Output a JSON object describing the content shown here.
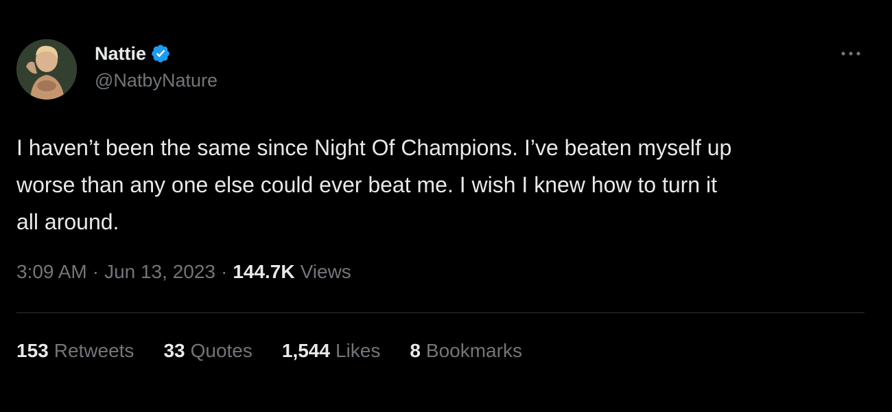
{
  "author": {
    "display_name": "Nattie",
    "handle": "@NatbyNature",
    "verified": true,
    "avatar_icon": "profile-photo"
  },
  "tweet": {
    "text": "I haven’t been the same since Night Of Champions. I’ve beaten myself up\nworse than any one else could ever beat me. I wish I knew how to turn it\nall around."
  },
  "meta": {
    "time": "3:09 AM",
    "separator": "·",
    "date": "Jun 13, 2023",
    "views_count": "144.7K",
    "views_label": "Views"
  },
  "stats": {
    "retweets_count": "153",
    "retweets_label": "Retweets",
    "quotes_count": "33",
    "quotes_label": "Quotes",
    "likes_count": "1,544",
    "likes_label": "Likes",
    "bookmarks_count": "8",
    "bookmarks_label": "Bookmarks"
  },
  "icons": {
    "more": "more-horizontal-icon",
    "verified": "verified-badge-icon"
  },
  "colors": {
    "background": "#000000",
    "primary_text": "#e7e9ea",
    "secondary_text": "#71767b",
    "verified_blue": "#1d9bf0",
    "divider": "#2f3336"
  }
}
